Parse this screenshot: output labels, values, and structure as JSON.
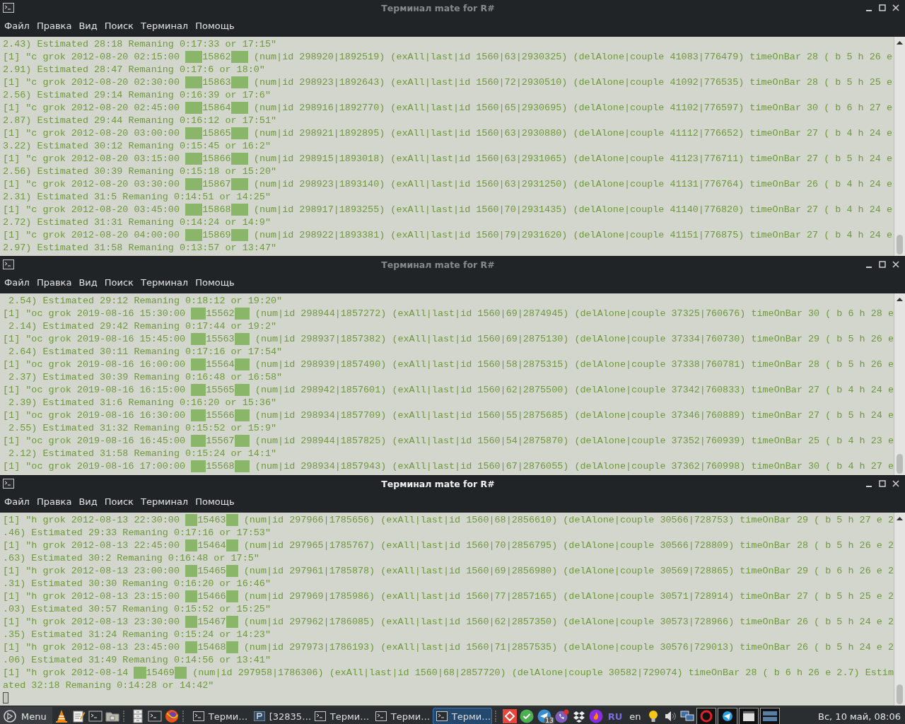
{
  "windows": [
    {
      "title": "Терминал mate for R#",
      "active": false,
      "menu": [
        "Файл",
        "Правка",
        "Вид",
        "Поиск",
        "Терминал",
        "Помощь"
      ],
      "lines": [
        {
          "kind": "plain",
          "text": "2.43) Estimated 28:18 Remaning 0:17:33 or 17:15\""
        },
        {
          "kind": "record",
          "before": "[1] \"c grok 2012-08-20 02:15:00 ",
          "mark": "15862",
          "after": " (num|id 298920|1892519) (exAll|last|id 1560|63|2930325) (delAlone|couple 41083|776479) timeOnBar 28 ( b 5 h 26 e"
        },
        {
          "kind": "plain",
          "text": "2.91) Estimated 28:47 Remaning 0:17:6 or 18:0\""
        },
        {
          "kind": "record",
          "before": "[1] \"c grok 2012-08-20 02:30:00 ",
          "mark": "15863",
          "after": " (num|id 298923|1892643) (exAll|last|id 1560|72|2930510) (delAlone|couple 41092|776535) timeOnBar 28 ( b 5 h 25 e"
        },
        {
          "kind": "plain",
          "text": "2.56) Estimated 29:14 Remaning 0:16:39 or 17:6\""
        },
        {
          "kind": "record",
          "before": "[1] \"c grok 2012-08-20 02:45:00 ",
          "mark": "15864",
          "after": " (num|id 298916|1892770) (exAll|last|id 1560|65|2930695) (delAlone|couple 41102|776597) timeOnBar 30 ( b 6 h 27 e"
        },
        {
          "kind": "plain",
          "text": "2.87) Estimated 29:44 Remaning 0:16:12 or 17:51\""
        },
        {
          "kind": "record",
          "before": "[1] \"c grok 2012-08-20 03:00:00 ",
          "mark": "15865",
          "after": " (num|id 298921|1892895) (exAll|last|id 1560|63|2930880) (delAlone|couple 41112|776652) timeOnBar 27 ( b 4 h 24 e"
        },
        {
          "kind": "plain",
          "text": "3.22) Estimated 30:12 Remaning 0:15:45 or 16:2\""
        },
        {
          "kind": "record",
          "before": "[1] \"c grok 2012-08-20 03:15:00 ",
          "mark": "15866",
          "after": " (num|id 298915|1893018) (exAll|last|id 1560|63|2931065) (delAlone|couple 41123|776711) timeOnBar 27 ( b 5 h 24 e"
        },
        {
          "kind": "plain",
          "text": "2.56) Estimated 30:39 Remaning 0:15:18 or 15:20\""
        },
        {
          "kind": "record",
          "before": "[1] \"c grok 2012-08-20 03:30:00 ",
          "mark": "15867",
          "after": " (num|id 298923|1893140) (exAll|last|id 1560|63|2931250) (delAlone|couple 41131|776764) timeOnBar 26 ( b 4 h 24 e"
        },
        {
          "kind": "plain",
          "text": "2.31) Estimated 31:5 Remaning 0:14:51 or 14:25\""
        },
        {
          "kind": "record",
          "before": "[1] \"c grok 2012-08-20 03:45:00 ",
          "mark": "15868",
          "after": " (num|id 298917|1893255) (exAll|last|id 1560|70|2931435) (delAlone|couple 41140|776820) timeOnBar 27 ( b 4 h 24 e"
        },
        {
          "kind": "plain",
          "text": "2.72) Estimated 31:31 Remaning 0:14:24 or 14:9\""
        },
        {
          "kind": "record",
          "before": "[1] \"c grok 2012-08-20 04:00:00 ",
          "mark": "15869",
          "after": " (num|id 298922|1893381) (exAll|last|id 1560|79|2931620) (delAlone|couple 41151|776875) timeOnBar 27 ( b 4 h 24 e"
        },
        {
          "kind": "plain",
          "text": "2.97) Estimated 31:58 Remaning 0:13:57 or 13:47\""
        }
      ]
    },
    {
      "title": "Терминал mate for R#",
      "active": false,
      "menu": [
        "Файл",
        "Правка",
        "Вид",
        "Поиск",
        "Терминал",
        "Помощь"
      ],
      "lines": [
        {
          "kind": "plain",
          "text": " 2.54) Estimated 29:12 Remaning 0:18:12 or 19:20\""
        },
        {
          "kind": "record",
          "before": "[1] \"oc grok 2019-08-16 15:30:00 ",
          "mark": "15562",
          "after": " (num|id 298944|1857272) (exAll|last|id 1560|69|2874945) (delAlone|couple 37325|760676) timeOnBar 30 ( b 6 h 28 e"
        },
        {
          "kind": "plain",
          "text": " 2.14) Estimated 29:42 Remaning 0:17:44 or 19:2\""
        },
        {
          "kind": "record",
          "before": "[1] \"oc grok 2019-08-16 15:45:00 ",
          "mark": "15563",
          "after": " (num|id 298937|1857382) (exAll|last|id 1560|69|2875130) (delAlone|couple 37334|760730) timeOnBar 29 ( b 5 h 26 e"
        },
        {
          "kind": "plain",
          "text": " 2.64) Estimated 30:11 Remaning 0:17:16 or 17:54\""
        },
        {
          "kind": "record",
          "before": "[1] \"oc grok 2019-08-16 16:00:00 ",
          "mark": "15564",
          "after": " (num|id 298939|1857490) (exAll|last|id 1560|58|2875315) (delAlone|couple 37338|760781) timeOnBar 28 ( b 5 h 26 e"
        },
        {
          "kind": "plain",
          "text": " 2.37) Estimated 30:39 Remaning 0:16:48 or 16:58\""
        },
        {
          "kind": "record",
          "before": "[1] \"oc grok 2019-08-16 16:15:00 ",
          "mark": "15565",
          "after": " (num|id 298942|1857601) (exAll|last|id 1560|62|2875500) (delAlone|couple 37342|760833) timeOnBar 27 ( b 4 h 24 e"
        },
        {
          "kind": "plain",
          "text": " 2.39) Estimated 31:6 Remaning 0:16:20 or 15:36\""
        },
        {
          "kind": "record",
          "before": "[1] \"oc grok 2019-08-16 16:30:00 ",
          "mark": "15566",
          "after": " (num|id 298934|1857709) (exAll|last|id 1560|55|2875685) (delAlone|couple 37346|760889) timeOnBar 27 ( b 5 h 24 e"
        },
        {
          "kind": "plain",
          "text": " 2.55) Estimated 31:32 Remaning 0:15:52 or 15:9\""
        },
        {
          "kind": "record",
          "before": "[1] \"oc grok 2019-08-16 16:45:00 ",
          "mark": "15567",
          "after": " (num|id 298944|1857825) (exAll|last|id 1560|54|2875870) (delAlone|couple 37352|760939) timeOnBar 25 ( b 4 h 23 e"
        },
        {
          "kind": "plain",
          "text": " 2.12) Estimated 31:58 Remaning 0:15:24 or 14:1\""
        },
        {
          "kind": "record",
          "before": "[1] \"oc grok 2019-08-16 17:00:00 ",
          "mark": "15568",
          "after": " (num|id 298934|1857943) (exAll|last|id 1560|67|2876055) (delAlone|couple 37362|760998) timeOnBar 30 ( b 4 h 27 e"
        }
      ]
    },
    {
      "title": "Терминал mate for R#",
      "active": true,
      "menu": [
        "Файл",
        "Правка",
        "Вид",
        "Поиск",
        "Терминал",
        "Помощь"
      ],
      "cursor": true,
      "lines": [
        {
          "kind": "record",
          "before": "[1] \"h grok 2012-08-13 22:30:00 ",
          "mark": "15463",
          "after": " (num|id 297966|1785656) (exAll|last|id 1560|68|2856610) (delAlone|couple 30566|728753) timeOnBar 29 ( b 5 h 27 e 2"
        },
        {
          "kind": "plain",
          "text": ".46) Estimated 29:33 Remaning 0:17:16 or 17:53\""
        },
        {
          "kind": "record",
          "before": "[1] \"h grok 2012-08-13 22:45:00 ",
          "mark": "15464",
          "after": " (num|id 297965|1785767) (exAll|last|id 1560|70|2856795) (delAlone|couple 30566|728809) timeOnBar 28 ( b 5 h 26 e 2"
        },
        {
          "kind": "plain",
          "text": ".63) Estimated 30:2 Remaning 0:16:48 or 17:5\""
        },
        {
          "kind": "record",
          "before": "[1] \"h grok 2012-08-13 23:00:00 ",
          "mark": "15465",
          "after": " (num|id 297961|1785878) (exAll|last|id 1560|69|2856980) (delAlone|couple 30569|728865) timeOnBar 29 ( b 6 h 26 e 2"
        },
        {
          "kind": "plain",
          "text": ".31) Estimated 30:30 Remaning 0:16:20 or 16:46\""
        },
        {
          "kind": "record",
          "before": "[1] \"h grok 2012-08-13 23:15:00 ",
          "mark": "15466",
          "after": " (num|id 297969|1785986) (exAll|last|id 1560|77|2857165) (delAlone|couple 30571|728914) timeOnBar 27 ( b 5 h 25 e 2"
        },
        {
          "kind": "plain",
          "text": ".03) Estimated 30:57 Remaning 0:15:52 or 15:25\""
        },
        {
          "kind": "record",
          "before": "[1] \"h grok 2012-08-13 23:30:00 ",
          "mark": "15467",
          "after": " (num|id 297962|1786085) (exAll|last|id 1560|62|2857350) (delAlone|couple 30573|728966) timeOnBar 26 ( b 5 h 24 e 2"
        },
        {
          "kind": "plain",
          "text": ".35) Estimated 31:24 Remaning 0:15:24 or 14:23\""
        },
        {
          "kind": "record",
          "before": "[1] \"h grok 2012-08-13 23:45:00 ",
          "mark": "15468",
          "after": " (num|id 297973|1786193) (exAll|last|id 1560|71|2857535) (delAlone|couple 30576|729013) timeOnBar 26 ( b 5 h 24 e 2"
        },
        {
          "kind": "plain",
          "text": ".06) Estimated 31:49 Remaning 0:14:56 or 13:41\""
        },
        {
          "kind": "record",
          "before": "[1] \"h grok 2012-08-14 ",
          "mark": "15469",
          "after": " (num|id 297958|1786306) (exAll|last|id 1560|68|2857720) (delAlone|couple 30582|729074) timeOnBar 28 ( b 6 h 26 e 2.7) Estim"
        },
        {
          "kind": "plain",
          "text": "ated 32:18 Remaning 0:14:28 or 14:42\""
        }
      ]
    }
  ],
  "taskbar": {
    "menu_label": "Menu",
    "tasks": [
      {
        "kind": "terminal",
        "label": "Терми…",
        "selected": false
      },
      {
        "kind": "editor",
        "label": "[32835…",
        "selected": false
      },
      {
        "kind": "terminal",
        "label": "Терми…",
        "selected": false
      },
      {
        "kind": "terminal",
        "label": "Терми…",
        "selected": false
      },
      {
        "kind": "terminal",
        "label": "Терми…",
        "selected": true
      }
    ],
    "badge": "13",
    "layout": "RU",
    "language": "en",
    "clock": "Вс, 10 май, 08:06"
  }
}
